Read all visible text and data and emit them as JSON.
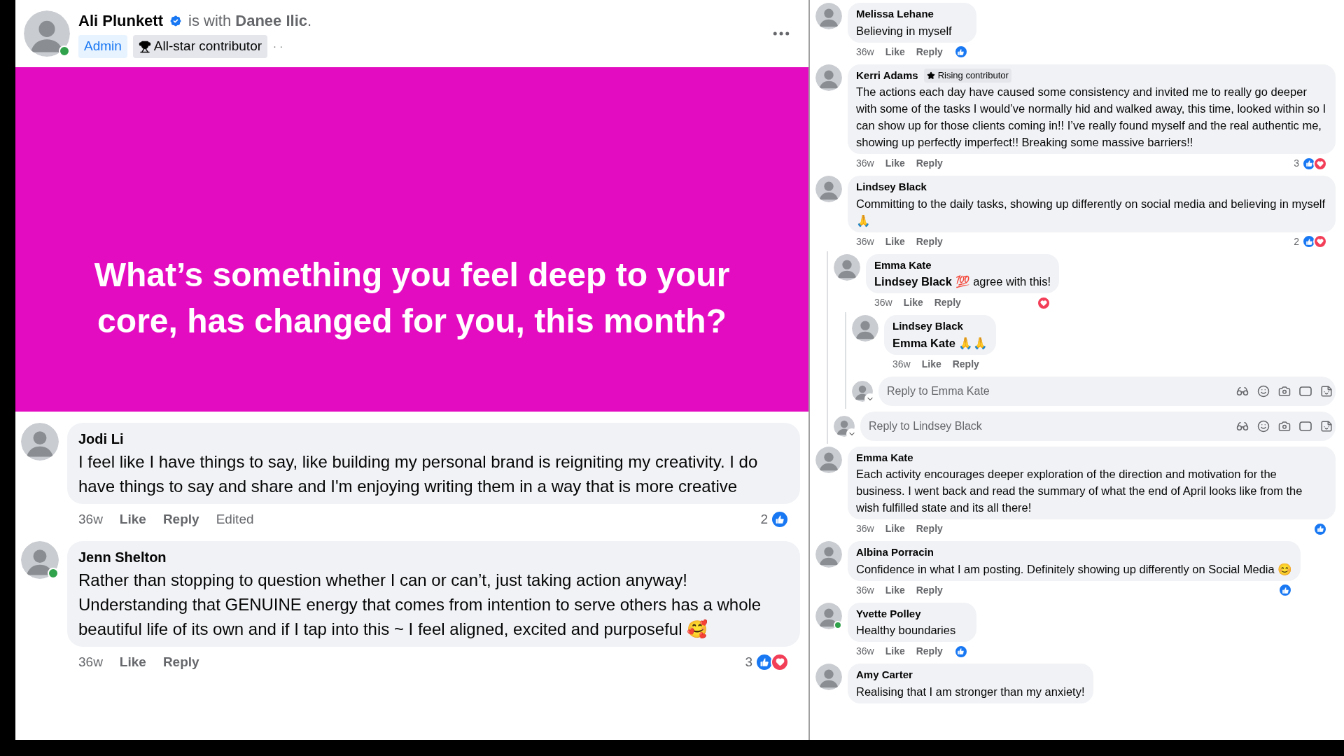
{
  "post": {
    "author": "Ali Plunkett",
    "verified": true,
    "online": true,
    "with_text": "is with **Danee Ilic**.",
    "badges": [
      {
        "kind": "role",
        "label": "Admin"
      },
      {
        "kind": "award",
        "label": "All-star contributor"
      }
    ],
    "meta": "· ·",
    "banner": "What’s something you feel deep to your core, has changed for you, this month?"
  },
  "comments": [
    {
      "kind": "comment",
      "name": "Jodi Li",
      "online": false,
      "text": "I feel like I have things to say, like building my personal brand is reigniting my creativity. I do have things to say and share and I'm enjoying writing them in a way that is more creative",
      "meta": [
        {
          "kind": "time",
          "label": "36w"
        },
        {
          "kind": "action",
          "label": "Like"
        },
        {
          "kind": "action",
          "label": "Reply"
        },
        {
          "kind": "note",
          "label": "Edited"
        }
      ],
      "reactions": {
        "count": "2",
        "like": true,
        "love": false
      }
    },
    {
      "kind": "comment",
      "name": "Jenn Shelton",
      "online": true,
      "text": "Rather than stopping to question whether I can or can’t, just taking action anyway! Understanding that GENUINE energy that comes from intention to serve others has a whole beautiful life of its own and if I tap into this ~ I feel aligned, excited and purposeful 🥰",
      "meta": [
        {
          "kind": "time",
          "label": "36w"
        },
        {
          "kind": "action",
          "label": "Like"
        },
        {
          "kind": "action",
          "label": "Reply"
        }
      ],
      "reactions": {
        "count": "3",
        "like": true,
        "love": true
      }
    }
  ],
  "side_comments": [
    {
      "kind": "comment",
      "name": "Melissa Lehane",
      "online": false,
      "text": "Believing in myself",
      "meta": [
        {
          "kind": "time",
          "label": "36w"
        },
        {
          "kind": "action",
          "label": "Like"
        },
        {
          "kind": "action",
          "label": "Reply"
        }
      ],
      "reactions": {
        "like": true,
        "love": false
      }
    },
    {
      "kind": "comment",
      "name": "Kerri Adams",
      "online": false,
      "badge": "Rising contributor",
      "text": "The actions each day have caused some consistency and invited me to really go deeper with some of the tasks I would’ve normally hid and walked away, this time, looked within so I can show up for those clients coming in!! I’ve really found myself and the real authentic me, showing up perfectly imperfect!! Breaking some massive barriers!!",
      "meta": [
        {
          "kind": "time",
          "label": "36w"
        },
        {
          "kind": "action",
          "label": "Like"
        },
        {
          "kind": "action",
          "label": "Reply"
        }
      ],
      "reactions": {
        "count": "3",
        "like": true,
        "love": true
      }
    },
    {
      "kind": "comment",
      "name": "Lindsey Black",
      "online": false,
      "text": "Committing to the daily tasks, showing up differently on social media and believing in myself 🙏",
      "meta": [
        {
          "kind": "time",
          "label": "36w"
        },
        {
          "kind": "action",
          "label": "Like"
        },
        {
          "kind": "action",
          "label": "Reply"
        }
      ],
      "reactions": {
        "count": "2",
        "like": true,
        "love": true
      },
      "children": [
        {
          "kind": "comment",
          "name": "Emma Kate",
          "online": false,
          "text": "**Lindsey Black** 💯 agree with this!",
          "meta": [
            {
              "kind": "time",
              "label": "36w"
            },
            {
              "kind": "action",
              "label": "Like"
            },
            {
              "kind": "action",
              "label": "Reply"
            }
          ],
          "reactions": {
            "like": false,
            "love": true
          },
          "children": [
            {
              "kind": "comment",
              "name": "Lindsey Black",
              "online": false,
              "text": "**Emma Kate** 🙏🙏",
              "meta": [
                {
                  "kind": "time",
                  "label": "36w"
                },
                {
                  "kind": "action",
                  "label": "Like"
                },
                {
                  "kind": "action",
                  "label": "Reply"
                }
              ]
            },
            {
              "kind": "reply_box",
              "placeholder": "Reply to Emma Kate"
            }
          ]
        },
        {
          "kind": "reply_box",
          "placeholder": "Reply to Lindsey Black"
        }
      ]
    },
    {
      "kind": "comment",
      "name": "Emma Kate",
      "online": false,
      "text": "Each activity encourages deeper exploration of the direction and motivation for the business. I went back and read the summary of what the end of April looks like from the wish fulfilled state and its all there!",
      "meta": [
        {
          "kind": "time",
          "label": "36w"
        },
        {
          "kind": "action",
          "label": "Like"
        },
        {
          "kind": "action",
          "label": "Reply"
        }
      ],
      "reactions": {
        "like": true,
        "love": false
      }
    },
    {
      "kind": "comment",
      "name": "Albina Porracin",
      "online": false,
      "text": "Confidence in what I am posting. Definitely showing up differently on Social Media 😊",
      "meta": [
        {
          "kind": "time",
          "label": "36w"
        },
        {
          "kind": "action",
          "label": "Like"
        },
        {
          "kind": "action",
          "label": "Reply"
        }
      ],
      "reactions": {
        "like": true,
        "love": false
      }
    },
    {
      "kind": "comment",
      "name": "Yvette Polley",
      "online": true,
      "text": "Healthy boundaries",
      "meta": [
        {
          "kind": "time",
          "label": "36w"
        },
        {
          "kind": "action",
          "label": "Like"
        },
        {
          "kind": "action",
          "label": "Reply"
        }
      ],
      "reactions": {
        "like": true,
        "love": false
      }
    },
    {
      "kind": "comment",
      "name": "Amy Carter",
      "online": false,
      "text": "Realising that I am stronger than my anxiety!"
    }
  ]
}
